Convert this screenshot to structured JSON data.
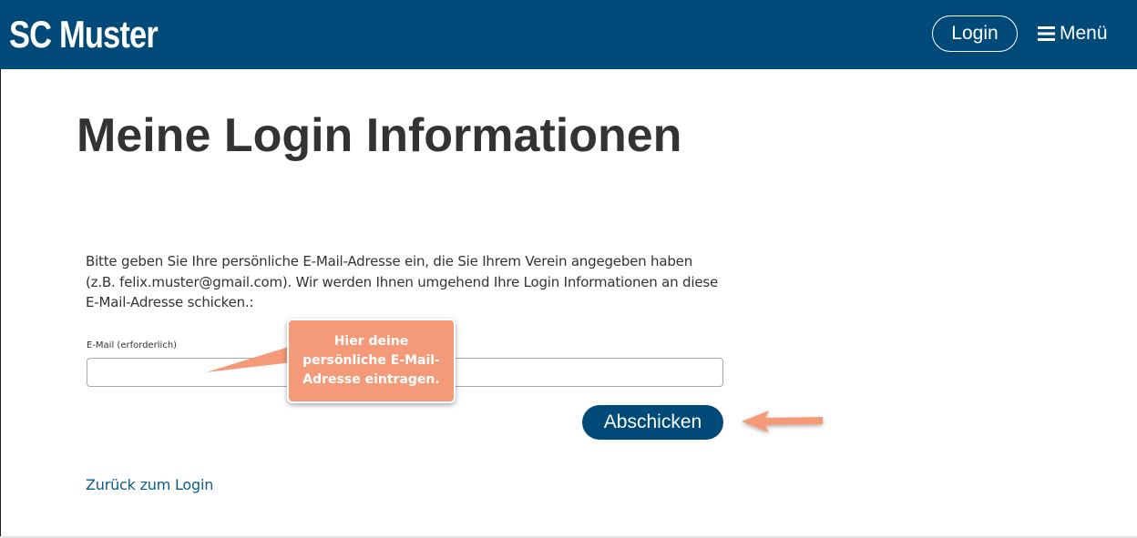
{
  "header": {
    "brand": "SC Muster",
    "login_label": "Login",
    "menu_label": "Menü",
    "background": "#004a7a"
  },
  "main": {
    "title": "Meine Login Informationen",
    "intro_text": "Bitte geben Sie Ihre persönliche E-Mail-Adresse ein, die Sie Ihrem Verein angegeben haben (z.B. felix.muster@gmail.com). Wir werden Ihnen umgehend Ihre Login Informationen an diese E-Mail-Adresse schicken.:",
    "email_label": "E-Mail (erforderlich)",
    "email_value": "",
    "submit_label": "Abschicken",
    "back_link": "Zurück zum Login"
  },
  "annotation": {
    "callout_text": "Hier deine persönliche E-Mail-Adresse eintragen.",
    "color": "#f59a78"
  },
  "icons": {
    "menu": "hamburger-icon",
    "arrow": "arrow-left-icon"
  }
}
